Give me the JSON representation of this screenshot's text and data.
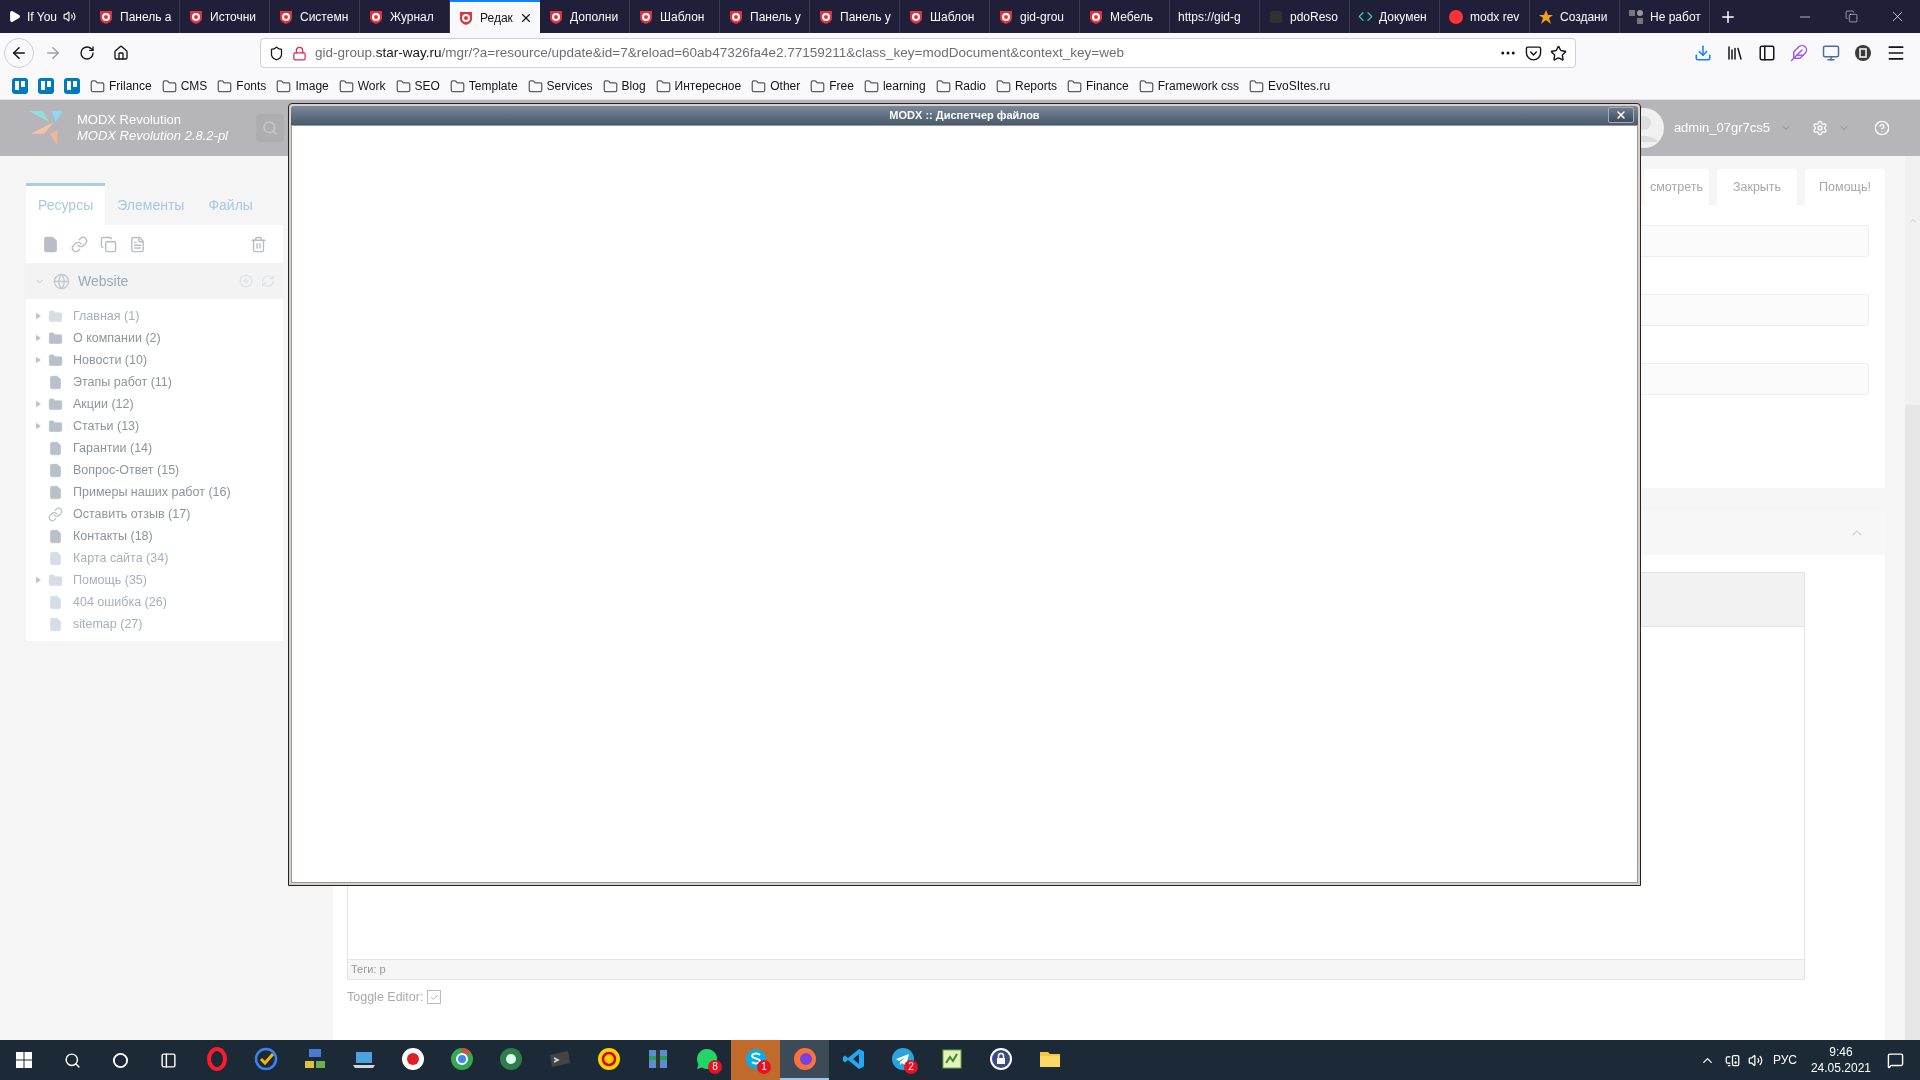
{
  "browser": {
    "tabs": [
      {
        "title": "If You",
        "kind": "media",
        "selected": false
      },
      {
        "title": "Панель а",
        "kind": "shield",
        "selected": false
      },
      {
        "title": "Источни",
        "kind": "shield",
        "selected": false
      },
      {
        "title": "Системн",
        "kind": "shield",
        "selected": false
      },
      {
        "title": "Журнал",
        "kind": "shield",
        "selected": false
      },
      {
        "title": "Редак",
        "kind": "shield",
        "selected": true
      },
      {
        "title": "Дополни",
        "kind": "shield",
        "selected": false
      },
      {
        "title": "Шаблон",
        "kind": "shield",
        "selected": false
      },
      {
        "title": "Панель у",
        "kind": "shield",
        "selected": false
      },
      {
        "title": "Панель у",
        "kind": "shield",
        "selected": false
      },
      {
        "title": "Шаблон",
        "kind": "shield",
        "selected": false
      },
      {
        "title": "gid-grou",
        "kind": "shield",
        "selected": false
      },
      {
        "title": "Мебель",
        "kind": "shield",
        "selected": false
      },
      {
        "title": "https://gid-g",
        "kind": "plain",
        "selected": false
      },
      {
        "title": "pdoReso",
        "kind": "dark",
        "selected": false
      },
      {
        "title": "Докумен",
        "kind": "code",
        "selected": false
      },
      {
        "title": "modx rev",
        "kind": "round",
        "selected": false
      },
      {
        "title": "Создани",
        "kind": "star",
        "selected": false
      },
      {
        "title": "Не работ",
        "kind": "puzzle",
        "selected": false
      }
    ],
    "url": {
      "host": "gid-group.",
      "domain": "star-way.ru",
      "path": "/mgr/?a=resource/update&id=7&reload=60ab47326fa4e2.77159211&class_key=modDocument&context_key=web"
    },
    "bookmarks": [
      "Frilance",
      "CMS",
      "Fonts",
      "Image",
      "Work",
      "SEO",
      "Template",
      "Services",
      "Blog",
      "Интересное",
      "Other",
      "Free",
      "learning",
      "Radio",
      "Reports",
      "Finance",
      "Framework css",
      "EvoSItes.ru"
    ]
  },
  "manager": {
    "brand": "MODX Revolution",
    "version": "MODX Revolution 2.8.2-pl",
    "user": "admin_07gr7cs5",
    "sidebar_tabs": [
      {
        "label": "Ресурсы",
        "selected": true
      },
      {
        "label": "Элементы",
        "selected": false
      },
      {
        "label": "Файлы",
        "selected": false
      }
    ],
    "context": "Website",
    "tree": [
      {
        "label": "Главная (1)",
        "kind": "folder",
        "expandable": true,
        "published": false
      },
      {
        "label": "О компании (2)",
        "kind": "folder",
        "expandable": true,
        "published": true
      },
      {
        "label": "Новости (10)",
        "kind": "folder",
        "expandable": true,
        "published": true
      },
      {
        "label": "Этапы работ (11)",
        "kind": "document",
        "expandable": false,
        "published": true
      },
      {
        "label": "Акции (12)",
        "kind": "folder",
        "expandable": true,
        "published": true
      },
      {
        "label": "Статьи (13)",
        "kind": "folder",
        "expandable": true,
        "published": true
      },
      {
        "label": "Гарантии (14)",
        "kind": "document",
        "expandable": false,
        "published": true
      },
      {
        "label": "Вопрос-Ответ (15)",
        "kind": "document",
        "expandable": false,
        "published": true
      },
      {
        "label": "Примеры наших работ (16)",
        "kind": "document",
        "expandable": false,
        "published": true
      },
      {
        "label": "Оставить отзыв (17)",
        "kind": "weblink",
        "expandable": false,
        "published": true
      },
      {
        "label": "Контакты (18)",
        "kind": "document",
        "expandable": false,
        "published": true
      },
      {
        "label": "Карта сайта (34)",
        "kind": "document",
        "expandable": false,
        "published": false
      },
      {
        "label": "Помощь (35)",
        "kind": "folder",
        "expandable": true,
        "published": false
      },
      {
        "label": "404 ошибка (26)",
        "kind": "document",
        "expandable": false,
        "published": false
      },
      {
        "label": "sitemap (27)",
        "kind": "document",
        "expandable": false,
        "published": false
      }
    ],
    "buttons": [
      "смотреть",
      "Закрыть",
      "Помощь!"
    ],
    "editor": {
      "status": "Теги: p",
      "toggle_label": "Toggle Editor:",
      "toggle_checked": true
    }
  },
  "dialog": {
    "title": "MODX :: Диспетчер файлов"
  },
  "taskbar": {
    "apps": [
      {
        "kind": "opera",
        "selected": false,
        "flashing": false
      },
      {
        "kind": "check",
        "selected": false,
        "flashing": false
      },
      {
        "kind": "network",
        "selected": false,
        "flashing": false
      },
      {
        "kind": "laptop",
        "selected": false,
        "flashing": false
      },
      {
        "kind": "record",
        "selected": false,
        "flashing": false
      },
      {
        "kind": "chrome",
        "selected": false,
        "flashing": false
      },
      {
        "kind": "hs",
        "selected": false,
        "flashing": false
      },
      {
        "kind": "terminal",
        "selected": false,
        "flashing": false
      },
      {
        "kind": "onec",
        "selected": false,
        "flashing": false
      },
      {
        "kind": "archive",
        "selected": false,
        "flashing": false
      },
      {
        "kind": "whatsapp",
        "badge": "8",
        "selected": false,
        "flashing": false
      },
      {
        "kind": "skype",
        "badge": "1",
        "selected": false,
        "flashing": true
      },
      {
        "kind": "firefox",
        "selected": true,
        "flashing": false
      },
      {
        "kind": "vscode",
        "selected": false,
        "flashing": false
      },
      {
        "kind": "telegram",
        "badge": "2",
        "selected": false,
        "flashing": false
      },
      {
        "kind": "notepad",
        "selected": false,
        "flashing": false
      },
      {
        "kind": "lock",
        "selected": false,
        "flashing": false
      },
      {
        "kind": "folder",
        "selected": false,
        "flashing": false
      }
    ],
    "language": "РУС",
    "time": "9:46",
    "date": "24.05.2021"
  }
}
